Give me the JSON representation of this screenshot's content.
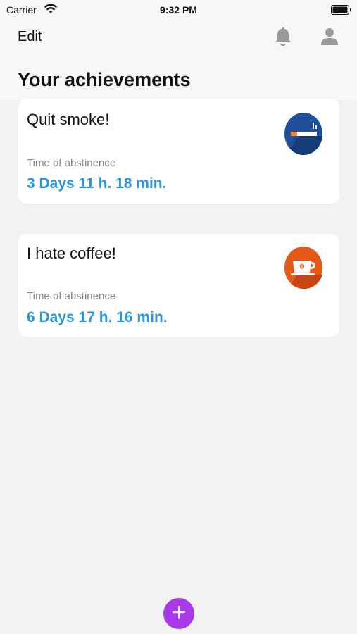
{
  "status_bar": {
    "carrier": "Carrier",
    "time": "9:32 PM"
  },
  "nav": {
    "edit_label": "Edit",
    "title": "Your achievements",
    "icons": [
      "bell-icon",
      "profile-icon"
    ]
  },
  "achievements": [
    {
      "title": "Quit smoke!",
      "label": "Time of abstinence",
      "value": "3 Days 11 h. 18 min.",
      "icon": "cigarette-icon"
    },
    {
      "title": "I hate coffee!",
      "label": "Time of abstinence",
      "value": "6 Days 17 h. 16 min.",
      "icon": "coffee-cup-icon"
    }
  ],
  "colors": {
    "accent_blue": "#2b95e0",
    "fab_purple": "#a839e6",
    "smoke_icon_bg": "#1f4f9a",
    "coffee_icon_bg": "#e55a18"
  }
}
